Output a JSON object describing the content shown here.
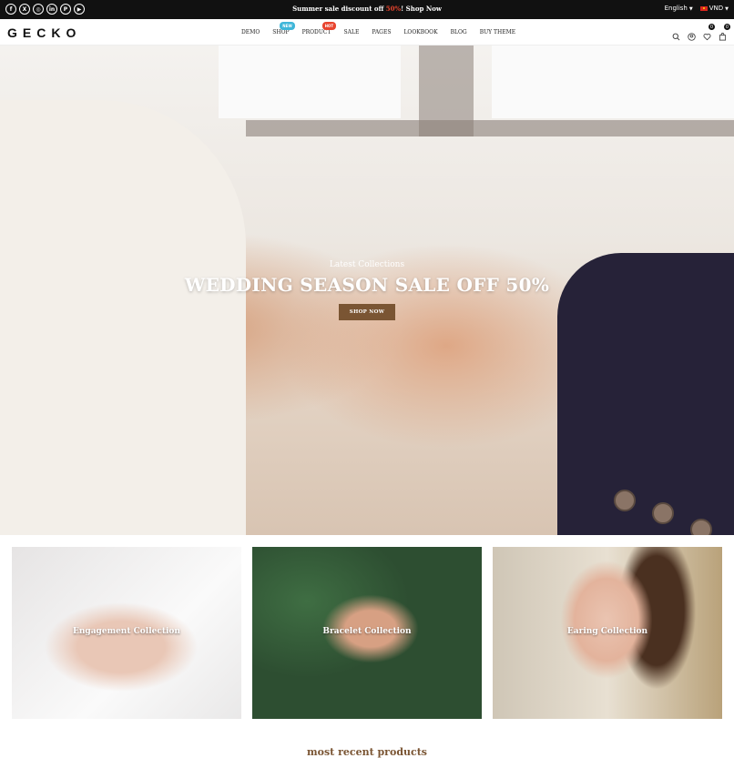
{
  "topbar": {
    "social": [
      {
        "icon": "facebook-icon",
        "glyph": "f"
      },
      {
        "icon": "x-twitter-icon",
        "glyph": "X"
      },
      {
        "icon": "instagram-icon",
        "glyph": "◎"
      },
      {
        "icon": "linkedin-icon",
        "glyph": "in"
      },
      {
        "icon": "pinterest-icon",
        "glyph": "P"
      },
      {
        "icon": "youtube-icon",
        "glyph": "▶"
      }
    ],
    "promo_pre": "Summer sale discount off ",
    "promo_pct": "50%",
    "promo_post": "! Shop Now",
    "language": "English",
    "currency": "VND"
  },
  "header": {
    "logo": "GECKO",
    "nav": [
      {
        "label": "DEMO",
        "badge": ""
      },
      {
        "label": "SHOP",
        "badge": "NEW"
      },
      {
        "label": "PRODUCT",
        "badge": "HOT"
      },
      {
        "label": "SALE",
        "badge": ""
      },
      {
        "label": "PAGES",
        "badge": ""
      },
      {
        "label": "LOOKBOOK",
        "badge": ""
      },
      {
        "label": "BLOG",
        "badge": ""
      },
      {
        "label": "BUY THEME",
        "badge": ""
      }
    ],
    "wishlist_count": "0",
    "cart_count": "0"
  },
  "hero": {
    "subtitle": "Latest Collections",
    "title": "WEDDING SEASON SALE OFF 50%",
    "button": "SHOP NOW"
  },
  "collections": [
    {
      "label": "Engagement Collection"
    },
    {
      "label": "Bracelet Collection"
    },
    {
      "label": "Earing Collection"
    }
  ],
  "section_title": "most recent products",
  "colors": {
    "accent": "#7a5533",
    "badge_new": "#3fb6d9",
    "badge_hot": "#e8442e",
    "topbar": "#111111"
  }
}
